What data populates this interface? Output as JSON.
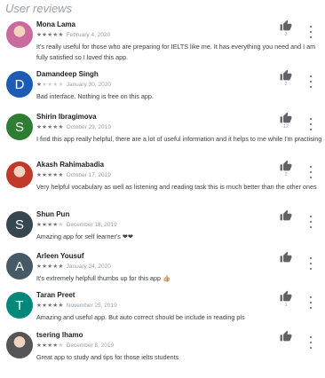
{
  "section_title": "User reviews",
  "reviews": [
    {
      "name": "Mona Lama",
      "rating": 5,
      "date": "February 4, 2020",
      "text": "It's really useful for those who are preparing for IELTS like me. It has everything you need and I am fully satisfied so I loved this app.",
      "helpful_count": "3",
      "avatar": {
        "type": "photo",
        "letter": "",
        "color": "#c96b9e"
      }
    },
    {
      "name": "Damandeep Singh",
      "rating": 1,
      "date": "January 30, 2020",
      "text": "Bad interface. Nothing is free on this app.",
      "helpful_count": "2",
      "avatar": {
        "type": "letter",
        "letter": "D",
        "color": "#1e5bb5"
      }
    },
    {
      "name": "Shirin Ibragimova",
      "rating": 5,
      "date": "October 29, 2019",
      "text": "I find this app really helpful, there are a lot of useful information and it helps to me while I'm practising",
      "helpful_count": "12",
      "avatar": {
        "type": "letter",
        "letter": "S",
        "color": "#2e7d32"
      }
    },
    {
      "name": "Akash Rahimabadia",
      "rating": 5,
      "date": "October 17, 2019",
      "text": "Very helpful vocabulary as well as listening and reading task this is much better than the other ones",
      "helpful_count": "2",
      "avatar": {
        "type": "photo",
        "letter": "",
        "color": "#c0392b"
      }
    },
    {
      "name": "Shun Pun",
      "rating": 4,
      "date": "December 18, 2019",
      "text": "Amazing app for self learner's ❤❤",
      "helpful_count": "",
      "avatar": {
        "type": "letter",
        "letter": "S",
        "color": "#37474f"
      }
    },
    {
      "name": "Arleen Yousuf",
      "rating": 5,
      "date": "January 24, 2020",
      "text": "It's extremely helpfull thumbs up for this app 👍🏼",
      "helpful_count": "",
      "avatar": {
        "type": "letter",
        "letter": "A",
        "color": "#455a64"
      }
    },
    {
      "name": "Taran Preet",
      "rating": 5,
      "date": "November 25, 2019",
      "text": "Amazing and useful app. But auto correct should be include in reading pls",
      "helpful_count": "1",
      "avatar": {
        "type": "letter",
        "letter": "T",
        "color": "#00897b"
      }
    },
    {
      "name": "tsering lhamo",
      "rating": 4,
      "date": "December 8, 2019",
      "text": "Great app to study and tips for those ielts students",
      "helpful_count": "",
      "avatar": {
        "type": "photo",
        "letter": "",
        "color": "#555555"
      }
    }
  ],
  "icons": {
    "helpful": "thumbs-up-icon",
    "more": "more-vert-icon",
    "star": "star-icon"
  },
  "colors": {
    "star_on": "#757575",
    "star_off": "#d0d0d0",
    "muted": "#9aa0a6"
  }
}
